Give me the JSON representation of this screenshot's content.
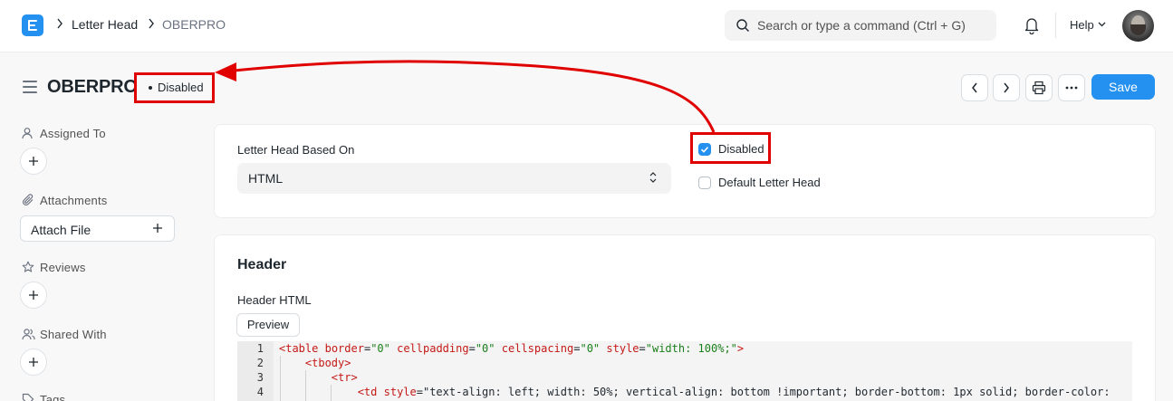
{
  "navbar": {
    "breadcrumbs": [
      "Letter Head",
      "OBERPRO"
    ],
    "search_placeholder": "Search or type a command (Ctrl + G)",
    "help_label": "Help"
  },
  "page": {
    "title": "OBERPRO",
    "status": "Disabled",
    "save_label": "Save"
  },
  "sidebar": {
    "assigned_to": "Assigned To",
    "attachments": "Attachments",
    "attach_file": "Attach File",
    "reviews": "Reviews",
    "shared_with": "Shared With",
    "tags": "Tags"
  },
  "form": {
    "based_on_label": "Letter Head Based On",
    "based_on_value": "HTML",
    "disabled_label": "Disabled",
    "disabled_checked": true,
    "default_label": "Default Letter Head",
    "default_checked": false
  },
  "header_section": {
    "title": "Header",
    "html_label": "Header HTML",
    "preview_label": "Preview",
    "code_lines": [
      {
        "num": "1",
        "text": "<table border=\"0\" cellpadding=\"0\" cellspacing=\"0\" style=\"width: 100%;\">"
      },
      {
        "num": "2",
        "text": "<tbody>"
      },
      {
        "num": "3",
        "text": "<tr>"
      },
      {
        "num": "4",
        "text": "<td style=\"text-align: left; width: 50%; vertical-align: bottom !important; border-bottom: 1px solid; border-color:"
      }
    ]
  },
  "colors": {
    "accent": "#2490ef",
    "annotation": "#e00000"
  }
}
